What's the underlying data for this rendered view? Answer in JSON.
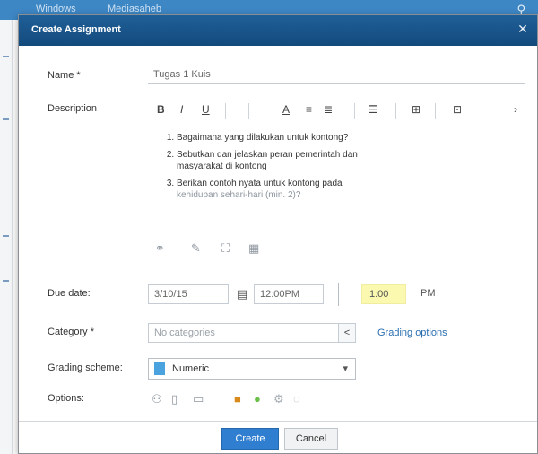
{
  "background_app": {
    "tabs": [
      "Windows",
      "Mediasaheb"
    ],
    "search_icon": "search-icon"
  },
  "dialog": {
    "title": "Create Assignment",
    "close_icon": "close-icon"
  },
  "form": {
    "name_label": "Name *",
    "name_value": "Tugas 1 Kuis",
    "description_label": "Description",
    "toolbar": [
      "B",
      "I",
      "U",
      "A",
      "≡",
      "≣",
      "☰",
      "⊞",
      "⊡"
    ],
    "description_items": [
      {
        "main": "Bagaimana yang dilakukan untuk kontong?",
        "sub": ""
      },
      {
        "main": "Sebutkan dan jelaskan peran pemerintah dan",
        "sub": "masyarakat di kontong"
      },
      {
        "main": "Berikan contoh nyata untuk kontong pada",
        "sub": "kehidupan sehari-hari (min. 2)?"
      }
    ],
    "attach_icons": [
      "link-icon",
      "edit-icon",
      "image-icon",
      "table-icon"
    ],
    "due_date_label": "Due date:",
    "due_date_value": "3/10/15",
    "time_value": "12:00PM",
    "hour_value": "1:00",
    "ampm": "PM",
    "category_label": "Category *",
    "category_placeholder": "No categories",
    "category_button": "<",
    "grading_link": "Grading options",
    "grading_scheme_label": "Grading scheme:",
    "grading_scheme_value": "Numeric",
    "options_label": "Options:"
  },
  "footer": {
    "create_label": "Create",
    "cancel_label": "Cancel"
  },
  "colors": {
    "titlebar": "#1a5a93",
    "primary_button": "#2f7ecf",
    "highlight_input": "#fbf9b0"
  }
}
